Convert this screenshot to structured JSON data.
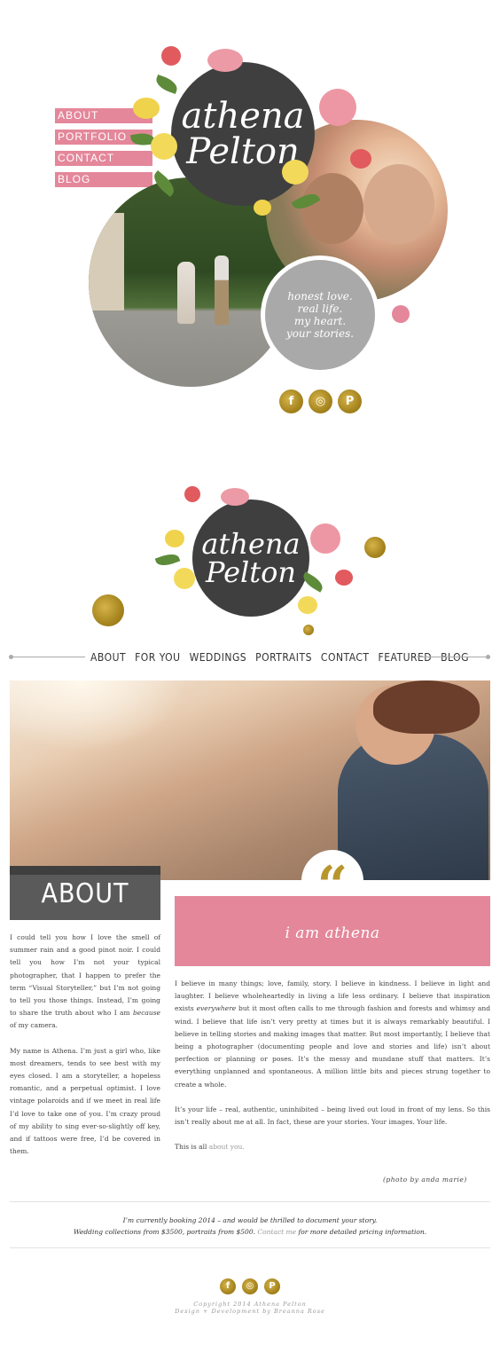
{
  "top_nav": {
    "about": "ABOUT",
    "portfolio": "PORTFOLIO",
    "contact": "CONTACT",
    "blog": "BLOG"
  },
  "logo": {
    "line1": "athena",
    "line2": "Pelton"
  },
  "tagline": {
    "line1": "honest love.",
    "line2": "real life.",
    "line3": "my heart.",
    "line4": "your stories."
  },
  "social_icons": [
    "facebook-icon",
    "instagram-icon",
    "pinterest-icon"
  ],
  "social_glyphs": {
    "facebook": "f",
    "instagram": "◎",
    "pinterest": "P"
  },
  "main_nav": [
    "ABOUT",
    "FOR YOU",
    "WEDDINGS",
    "PORTRAITS",
    "CONTACT",
    "FEATURED",
    "BLOG"
  ],
  "about": {
    "heading": "ABOUT",
    "quote_glyph": "“",
    "banner": "i am athena",
    "left_p1_a": "I could tell you how I love the smell of summer rain and a good pinot noir. I could tell you how I’m not your typical photographer, that I happen to prefer the term “Visual Storyteller,” but I’m not going to tell you those things. Instead, I’m going to share the truth about who I am ",
    "left_p1_em": "because",
    "left_p1_b": " of my camera.",
    "left_p2": "My name is Athena. I’m just a girl who, like most dreamers, tends to see best with my eyes closed. I am a storyteller, a hopeless romantic, and a perpetual optimist. I love vintage polaroids and if we meet in real life I’d love to take one of you. I’m crazy proud of my ability to sing ever-so-slightly off key, and if tattoos were free, I’d be covered in them.",
    "right_p1_a": "I believe in many things; love, family, story. I believe in kindness. I believe in light and laughter. I believe wholeheartedly in living a life less ordinary. I believe that inspiration exists ",
    "right_p1_em": "everywhere",
    "right_p1_b": " but it most often calls to me through fashion and forests and whimsy and wind. I believe that life isn’t very pretty at times but it is always remarkably beautiful. I believe in telling stories and making images that matter. But most importantly, I believe that being a photographer (documenting people and love and stories and life) isn’t about perfection or planning or poses. It’s the messy and mundane stuff that matters. It’s everything unplanned and spontaneous. A million little bits and pieces strung together to create a whole.",
    "right_p2": "It’s your life – real, authentic, uninhibited – being lived out loud in front of my lens. So this isn’t really about me at all. In fact, these are your stories. Your images. Your life.",
    "right_p3_a": "This is all ",
    "right_p3_link": "about you."
  },
  "photo_credit": "(photo by anda marie)",
  "booking": {
    "line1": "I’m currently booking 2014 – and would be thrilled to document your story.",
    "line2_a": "Wedding collections from $3500, portraits from $500. ",
    "line2_link": "Contact me",
    "line2_b": " for more detailed pricing information."
  },
  "footer": {
    "copyright": "Copyright 2014 Athena Pelton",
    "credit": "Design + Development by Breanna Rose"
  },
  "colors": {
    "pink": "#e4879a",
    "charcoal": "#3f3f3f",
    "gold": "#b8962d",
    "gray_circle": "#a9a9a9"
  }
}
